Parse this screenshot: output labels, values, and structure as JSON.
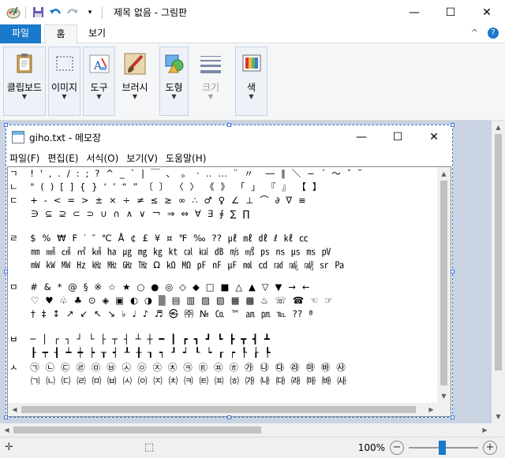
{
  "window": {
    "title": "제목 없음 - 그림판",
    "minimize": "—",
    "maximize": "☐",
    "close": "✕"
  },
  "quick_access": {
    "icons": [
      "paint-app-icon",
      "save-icon",
      "undo-icon",
      "redo-icon",
      "customize-dropdown-icon"
    ]
  },
  "tabs": {
    "file": "파일",
    "home": "홈",
    "view": "보기",
    "collapse": "^",
    "help": "?"
  },
  "ribbon": {
    "groups": [
      {
        "label": "클립보드"
      },
      {
        "label": "이미지"
      },
      {
        "label": "도구"
      },
      {
        "label": "브러시"
      },
      {
        "label": "도형"
      },
      {
        "label": "크기"
      },
      {
        "label": "색"
      }
    ]
  },
  "notepad": {
    "title": "giho.txt - 메모장",
    "minimize": "—",
    "maximize": "☐",
    "close": "✕",
    "menu": [
      "파일(F)",
      "편집(E)",
      "서식(O)",
      "보기(V)",
      "도움말(H)"
    ],
    "lines": [
      "ㄱ    !  '  ,  .  /  :  ;  ?  ^  _  `  |  ￣  、  。  ·  ‥  …  ¨  〃  ­  ―  ∥  ＼  ∼  ´  ～  ˇ  ˘",
      "ㄴ    \"  (  )  [  ]  {  }  ‘  ’  “  ”  〔  〕  〈  〉  《  》  「  」  『  』  【  】",
      "ㄷ    +  -  <  =  >  ±  ×  ÷  ≠  ≤  ≥  ∞  ∴  ♂  ♀  ∠  ⊥  ⌒  ∂  ∇  ≡",
      "       ∋  ⊆  ⊇  ⊂  ⊃  ∪  ∩  ∧  ∨  ￢  ⇒  ⇔  ∀  ∃  ∮  ∑  ∏",
      "",
      "ㄹ    $  %  ₩  F  ′  ″  ℃  Å  ¢  £  ¥  ¤  ℉  ‰  ??  ㎕  ㎖  ㎗  ℓ  ㎘  ㏄",
      "       ㎜  ㎟  ㎠  ㎡  ㎢  ㏊  ㎍  ㎎  ㎏  ㏏  ㎈  ㎉  ㏈  ㎧  ㎨  ㎰  ㎱  ㎲  ㎳  ㎴",
      "       ㎽  ㎾  ㎿  ㎐  ㎑  ㎒  ㎓  ㎔  Ω  ㏀  ㏁  ㎊  ㎋  ㎌  ㏖  ㏅  ㎭  ㎮  ㎯  ㏛  ㎩",
      "",
      "ㅁ    #  &  *  @  §  ※  ☆  ★  ○  ●  ◎  ◇  ◆  □  ■  △  ▲  ▽  ▼  →  ←",
      "       ♡  ♥  ♧  ♣  ⊙  ◈  ▣  ◐  ◑  ▒  ▤  ▥  ▨  ▧  ▦  ▩  ♨  ☏  ☎  ☜  ☞",
      "       †  ‡  ↕  ↗  ↙  ↖  ↘  ♭  ♩  ♪  ♬  ㉿  ㈜  №  ㏇  ™  ㏂  ㏘  ℡  ??  ª",
      "",
      "ㅂ    ─  │  ┌  ┐  ┘  └  ├  ┬  ┤  ┴  ┼  ━  ┃  ┏  ┓  ┛  ┗  ┣  ┳  ┫  ┻",
      "       ┠  ┯  ┨  ┷  ┿  ┝  ┰  ┥  ┸  ╂  ┒  ┑  ┚  ┙  ┖  ┕  ┎  ┍  ┞  ┟  ┡",
      "ㅅ    ㉠  ㉡  ㉢  ㉣  ㉤  ㉥  ㉦  ㉧  ㉨  ㉩  ㉪  ㉫  ㉬  ㉭  ㉮  ㉯  ㉰  ㉱  ㉲  ㉳  ㉴",
      "       ㈀  ㈁  ㈂  ㈃  ㈄  ㈅  ㈆  ㈇  ㈈  ㈉  ㈊  ㈋  ㈌  ㈍  ㈎  ㈏  ㈐  ㈑  ㈒  ㈓  ㈔"
    ]
  },
  "status": {
    "zoom": "100%",
    "zoom_out": "−",
    "zoom_in": "+"
  }
}
